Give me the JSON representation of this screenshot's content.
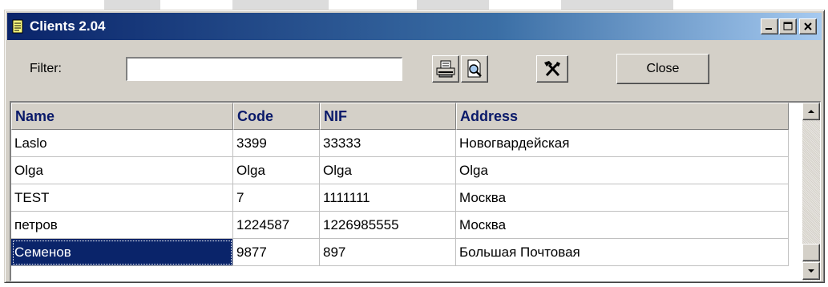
{
  "window": {
    "title": "Clients  2.04",
    "controls": [
      "minimize-icon",
      "maximize-icon",
      "close-icon"
    ]
  },
  "toolbar": {
    "filter_label": "Filter:",
    "filter_value": "",
    "buttons": [
      "print-icon",
      "print-preview-icon",
      "tools-icon"
    ],
    "close_label": "Close"
  },
  "grid": {
    "columns": [
      "Name",
      "Code",
      "NIF",
      "Address"
    ],
    "rows": [
      [
        "Laslo",
        "3399",
        "33333",
        "Новогвардейская"
      ],
      [
        "Olga",
        "Olga",
        "Olga",
        "Olga"
      ],
      [
        "TEST",
        "7",
        "1111111",
        "Москва"
      ],
      [
        "петров",
        "1224587",
        "1226985555",
        "Москва"
      ],
      [
        "Семенов",
        "9877",
        "897",
        "Большая Почтовая"
      ]
    ],
    "selected_row": 4,
    "selected_col": 0
  },
  "colors": {
    "title_gradient_start": "#0a246a",
    "title_gradient_end": "#a6caf0",
    "header_text": "#0a1a6a",
    "selection": "#0a246a",
    "face": "#d4d0c8"
  }
}
